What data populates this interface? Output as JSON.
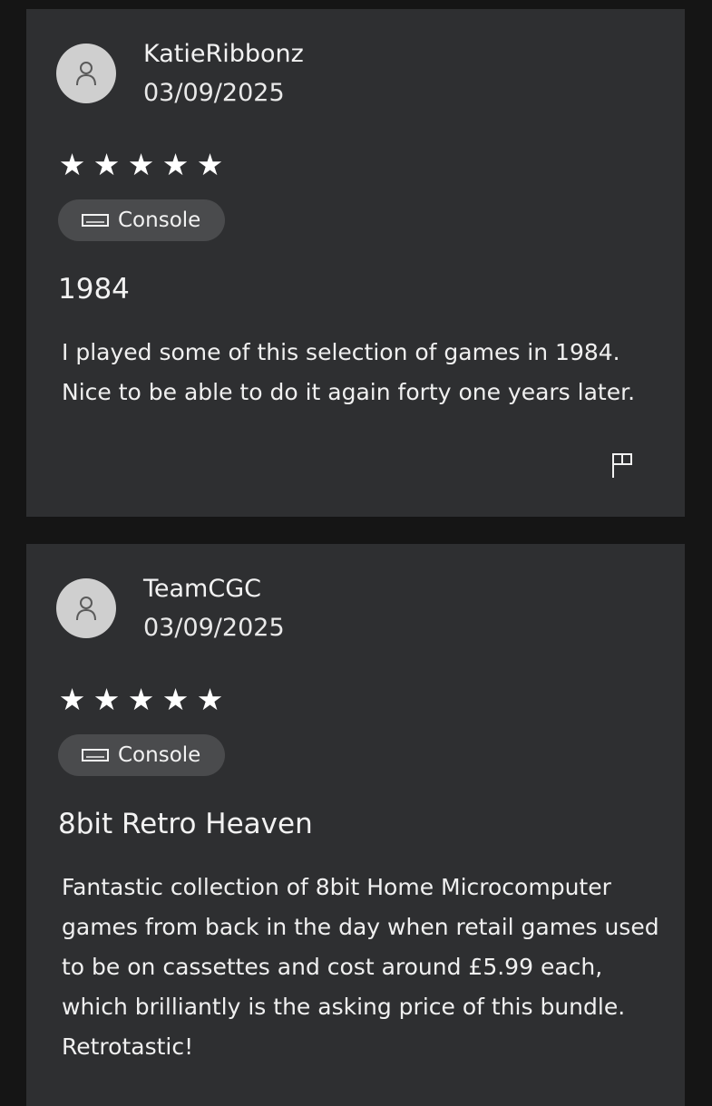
{
  "reviews": [
    {
      "username": "KatieRibbonz",
      "date": "03/09/2025",
      "rating": 5,
      "stars": [
        "★",
        "★",
        "★",
        "★",
        "★"
      ],
      "platform": "Console",
      "title": "1984",
      "body": "I played some of this selection of games in 1984. Nice to be able to do it again forty one years later."
    },
    {
      "username": "TeamCGC",
      "date": "03/09/2025",
      "rating": 5,
      "stars": [
        "★",
        "★",
        "★",
        "★",
        "★"
      ],
      "platform": "Console",
      "title": "8bit Retro Heaven",
      "body": "Fantastic collection of 8bit Home Microcomputer games from back in the day when retail games used to be on cassettes and cost around £5.99 each, which brilliantly is the asking price of this bundle. Retrotastic!"
    }
  ],
  "icons": {
    "avatar": "person-icon",
    "platform": "console-icon",
    "report": "flag-icon",
    "rating": "star-icon"
  },
  "colors": {
    "page_background": "#151515",
    "card_background": "#2e2f31",
    "pill_background": "#4a4b4d",
    "avatar_background": "#cfcfcf",
    "text": "#f2f2f2"
  }
}
